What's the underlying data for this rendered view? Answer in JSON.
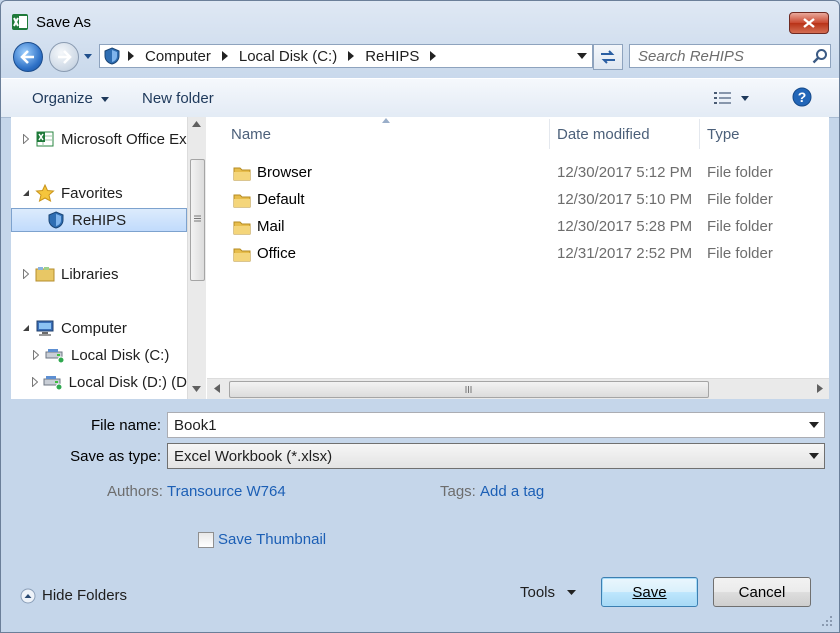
{
  "window": {
    "title": "Save As",
    "colors": {
      "accent": "#3c7fb1",
      "link": "#1c5fb5",
      "selection": "#c1dbfc"
    }
  },
  "address_bar": {
    "crumbs": [
      "Computer",
      "Local Disk (C:)",
      "ReHIPS"
    ]
  },
  "search": {
    "placeholder": "Search ReHIPS"
  },
  "toolbar": {
    "organize_label": "Organize",
    "new_folder_label": "New folder"
  },
  "nav_pane": {
    "items": [
      {
        "label": "Microsoft Office Ex",
        "icon": "excel-icon"
      },
      {
        "label": "Favorites",
        "icon": "star-icon"
      },
      {
        "label": "ReHIPS",
        "icon": "shield-icon",
        "selected": true
      },
      {
        "label": "Libraries",
        "icon": "libraries-icon"
      },
      {
        "label": "Computer",
        "icon": "computer-icon"
      },
      {
        "label": "Local Disk (C:)",
        "icon": "drive-icon"
      },
      {
        "label": "Local Disk (D:) (D",
        "icon": "drive-icon"
      }
    ]
  },
  "file_list": {
    "columns": [
      "Name",
      "Date modified",
      "Type"
    ],
    "rows": [
      {
        "name": "Browser",
        "date": "12/30/2017 5:12 PM",
        "type": "File folder"
      },
      {
        "name": "Default",
        "date": "12/30/2017 5:10 PM",
        "type": "File folder"
      },
      {
        "name": "Mail",
        "date": "12/30/2017 5:28 PM",
        "type": "File folder"
      },
      {
        "name": "Office",
        "date": "12/31/2017 2:52 PM",
        "type": "File folder"
      }
    ]
  },
  "form": {
    "file_name_label": "File name:",
    "file_name_value": "Book1",
    "save_type_label": "Save as type:",
    "save_type_value": "Excel Workbook (*.xlsx)",
    "authors_label": "Authors:",
    "authors_value": "Transource W764",
    "tags_label": "Tags:",
    "tags_value": "Add a tag",
    "thumbnail_label": "Save Thumbnail"
  },
  "footer": {
    "hide_folders_label": "Hide Folders",
    "tools_label": "Tools",
    "save_label": "Save",
    "cancel_label": "Cancel"
  }
}
